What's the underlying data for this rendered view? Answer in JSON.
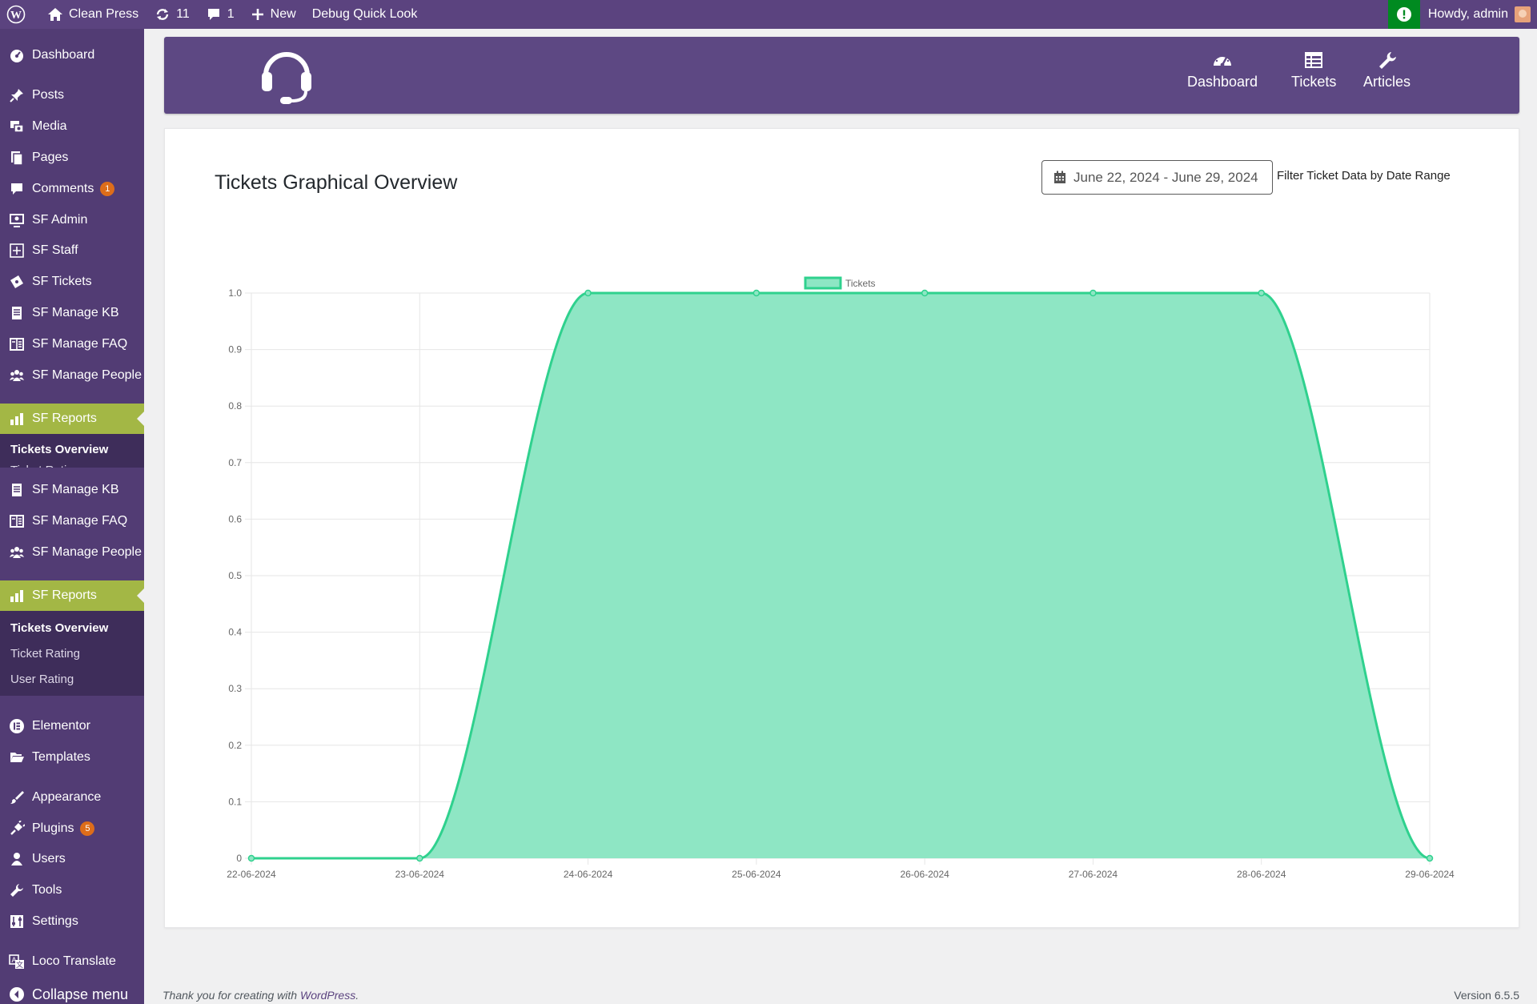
{
  "adminbar": {
    "site_name": "Clean Press",
    "updates_count": "11",
    "comments_count": "1",
    "new_label": "New",
    "debug_label": "Debug Quick Look",
    "howdy": "Howdy, admin"
  },
  "sidebar": {
    "items": {
      "dashboard": "Dashboard",
      "posts": "Posts",
      "media": "Media",
      "pages": "Pages",
      "comments": "Comments",
      "comments_badge": "1",
      "sf_admin": "SF Admin",
      "sf_staff": "SF Staff",
      "sf_tickets": "SF Tickets",
      "sf_manage_kb": "SF Manage KB",
      "sf_manage_faq": "SF Manage FAQ",
      "sf_manage_people": "SF Manage People",
      "sf_reports": "SF Reports",
      "elementor": "Elementor",
      "templates": "Templates",
      "appearance": "Appearance",
      "plugins": "Plugins",
      "plugins_badge": "5",
      "users": "Users",
      "tools": "Tools",
      "settings": "Settings",
      "loco_translate": "Loco Translate",
      "collapse_menu": "Collapse menu"
    },
    "reports_submenu": {
      "tickets_overview": "Tickets Overview",
      "ticket_rating": "Ticket Rating",
      "user_rating": "User Rating"
    }
  },
  "sf_header": {
    "nav": {
      "dashboard": "Dashboard",
      "tickets": "Tickets",
      "articles": "Articles"
    }
  },
  "main": {
    "title": "Tickets Graphical Overview",
    "date_range": "June 22, 2024 - June 29, 2024",
    "filter_label": "Filter Ticket Data by Date Range"
  },
  "chart_data": {
    "type": "area",
    "categories": [
      "22-06-2024",
      "23-06-2024",
      "24-06-2024",
      "25-06-2024",
      "26-06-2024",
      "27-06-2024",
      "28-06-2024",
      "29-06-2024"
    ],
    "series": [
      {
        "name": "Tickets",
        "values": [
          0,
          0,
          1,
          1,
          1,
          1,
          1,
          0
        ]
      }
    ],
    "ylim": [
      0,
      1.0
    ],
    "yticks": [
      "0",
      "0.1",
      "0.2",
      "0.3",
      "0.4",
      "0.5",
      "0.6",
      "0.7",
      "0.8",
      "0.9",
      "1.0"
    ],
    "grid": true,
    "legend": "top-center",
    "line_color": "#2fd18e",
    "fill_color": "#8ee6c4"
  },
  "footer": {
    "thanks_prefix": "Thank you for creating with ",
    "wordpress_link": "WordPress",
    "thanks_suffix": ".",
    "version": "Version 6.5.5"
  }
}
